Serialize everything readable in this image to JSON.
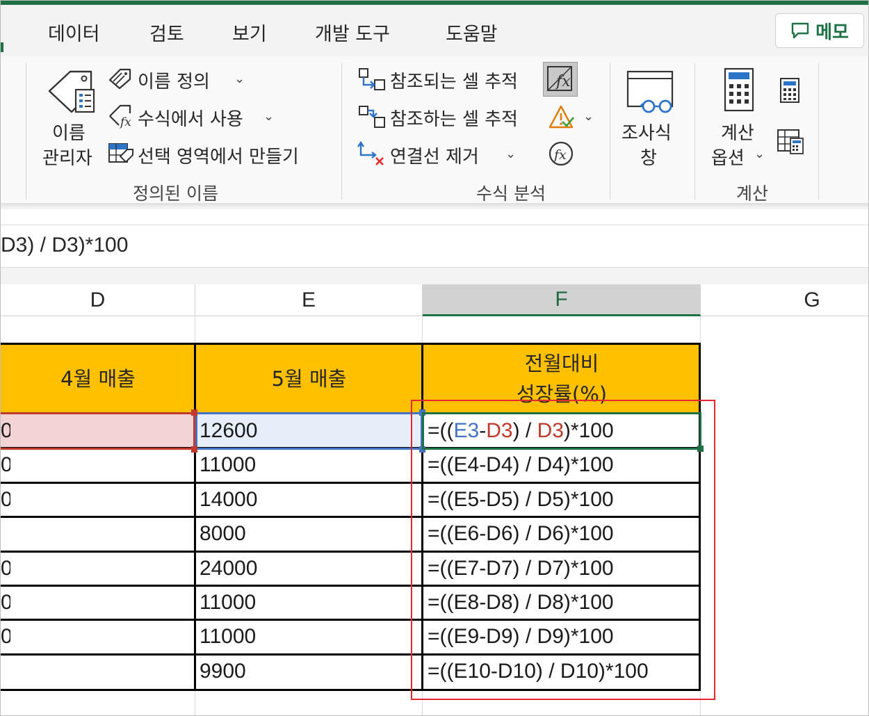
{
  "ribbon": {
    "tabs": [
      "데이터",
      "검토",
      "보기",
      "개발 도구",
      "도움말"
    ],
    "memo_label": "메모",
    "defined_names": {
      "name_manager_line1": "이름",
      "name_manager_line2": "관리자",
      "define_name": "이름 정의",
      "use_in_formula": "수식에서 사용",
      "create_from_selection": "선택 영역에서 만들기",
      "group_label": "정의된 이름"
    },
    "formula_auditing": {
      "trace_precedents": "참조되는 셀 추적",
      "trace_dependents": "참조하는 셀 추적",
      "remove_arrows": "연결선 제거",
      "group_label": "수식 분석"
    },
    "watch_window": {
      "line1": "조사식",
      "line2": "창"
    },
    "calculation": {
      "options_line1": "계산",
      "options_line2": "옵션",
      "group_label": "계산"
    }
  },
  "formula_bar": {
    "text": "D3) / D3)*100"
  },
  "columns": [
    "D",
    "E",
    "F",
    "G"
  ],
  "table": {
    "header_d": "4월 매출",
    "header_e": "5월 매출",
    "header_f_line1": "전월대비",
    "header_f_line2": "성장률(%)",
    "rows": [
      {
        "d": "0",
        "e": "12600",
        "f_prefix": "=((",
        "f_ref1": "E3",
        "f_dash": "-",
        "f_ref2": "D3",
        "f_mid": ") / ",
        "f_ref3": "D3",
        "f_suffix": ")*100"
      },
      {
        "d": "0",
        "e": "11000",
        "f": "=((E4-D4) / D4)*100"
      },
      {
        "d": "0",
        "e": "14000",
        "f": "=((E5-D5) / D5)*100"
      },
      {
        "d": "",
        "e": "8000",
        "f": "=((E6-D6) / D6)*100"
      },
      {
        "d": "0",
        "e": "24000",
        "f": "=((E7-D7) / D7)*100"
      },
      {
        "d": "0",
        "e": "11000",
        "f": "=((E8-D8) / D8)*100"
      },
      {
        "d": "0",
        "e": "11000",
        "f": "=((E9-D9) / D9)*100"
      },
      {
        "d": "",
        "e": "9900",
        "f": "=((E10-D10) / D10)*100"
      }
    ]
  },
  "colors": {
    "header_fill": "#ffc000",
    "excel_green": "#1e7145",
    "ref_blue": "#4472c4",
    "ref_red": "#c0392b",
    "highlight_red": "#e8262d"
  }
}
